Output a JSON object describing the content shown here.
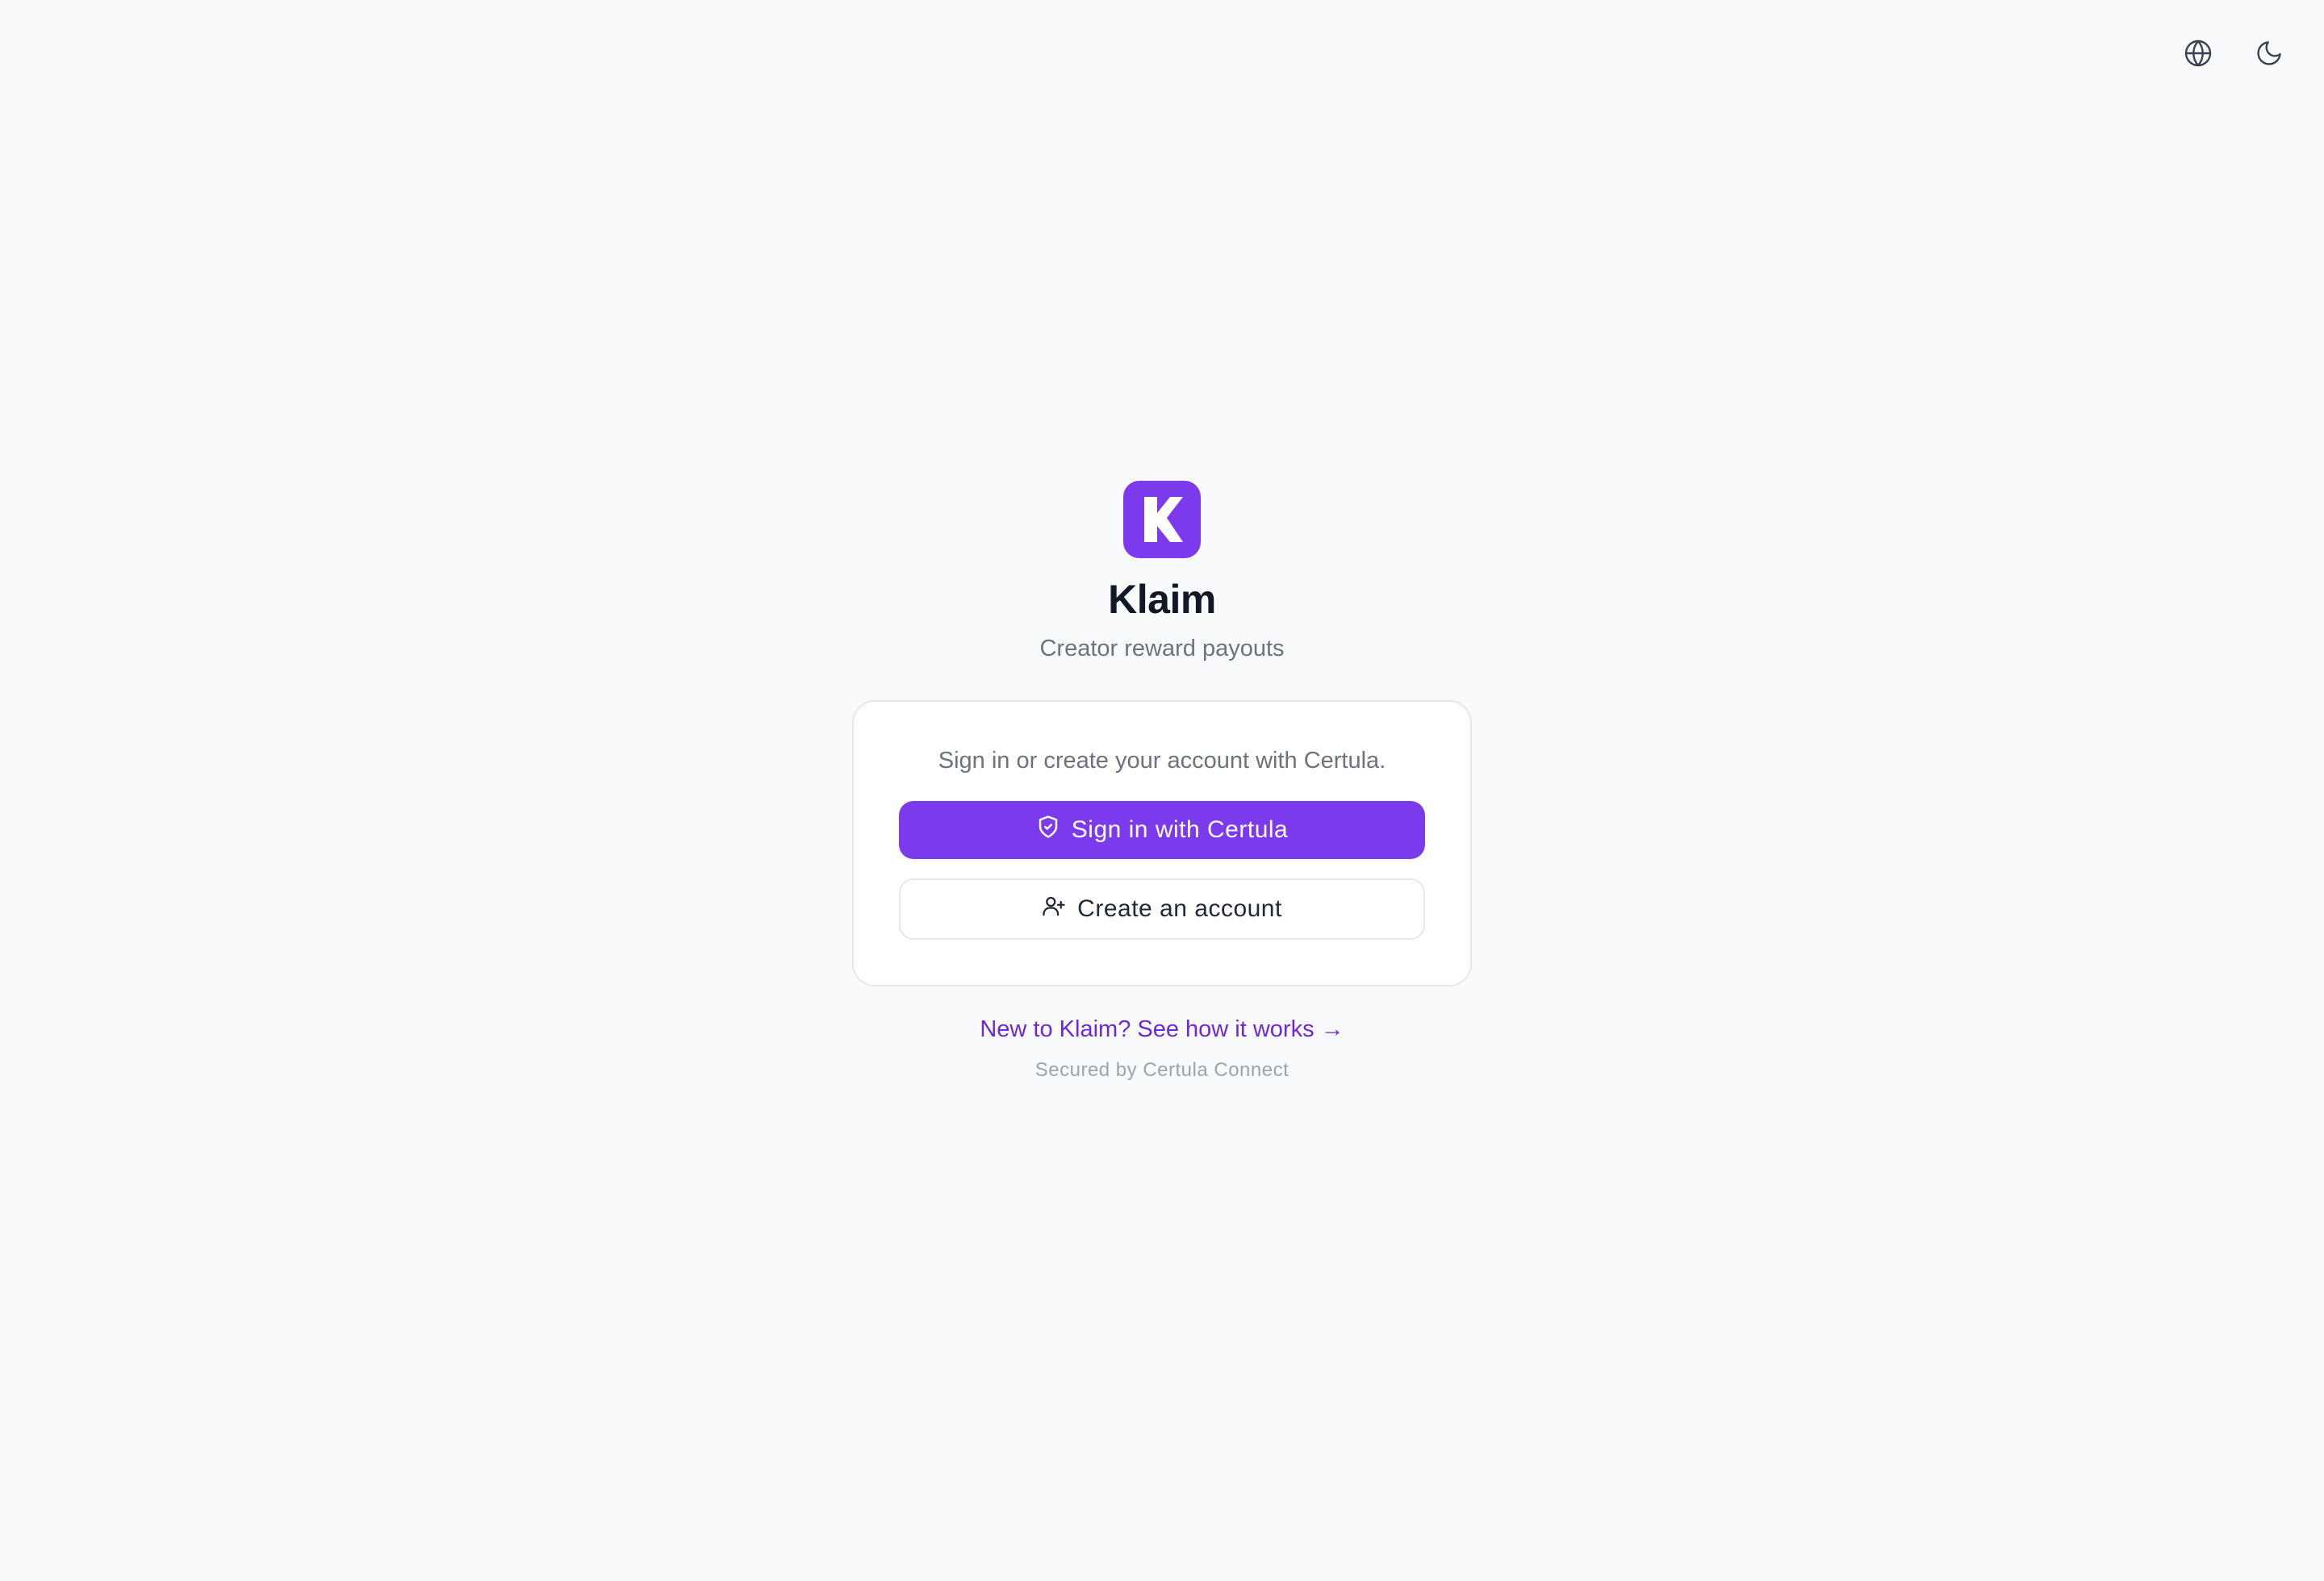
{
  "header": {
    "language_icon": "globe-icon",
    "theme_icon": "moon-icon"
  },
  "brand": {
    "logo_icon": "klaim-k-logo",
    "name": "Klaim",
    "tagline": "Creator reward payouts",
    "accent_color": "#7c3aed"
  },
  "card": {
    "prompt": "Sign in or create your account with Certula.",
    "sign_in_label": "Sign in with Certula",
    "sign_in_icon": "shield-check-icon",
    "create_label": "Create an account",
    "create_icon": "user-plus-icon"
  },
  "footer": {
    "how_it_works_link": "New to Klaim? See how it works →",
    "secured_by": "Secured by Certula Connect"
  }
}
